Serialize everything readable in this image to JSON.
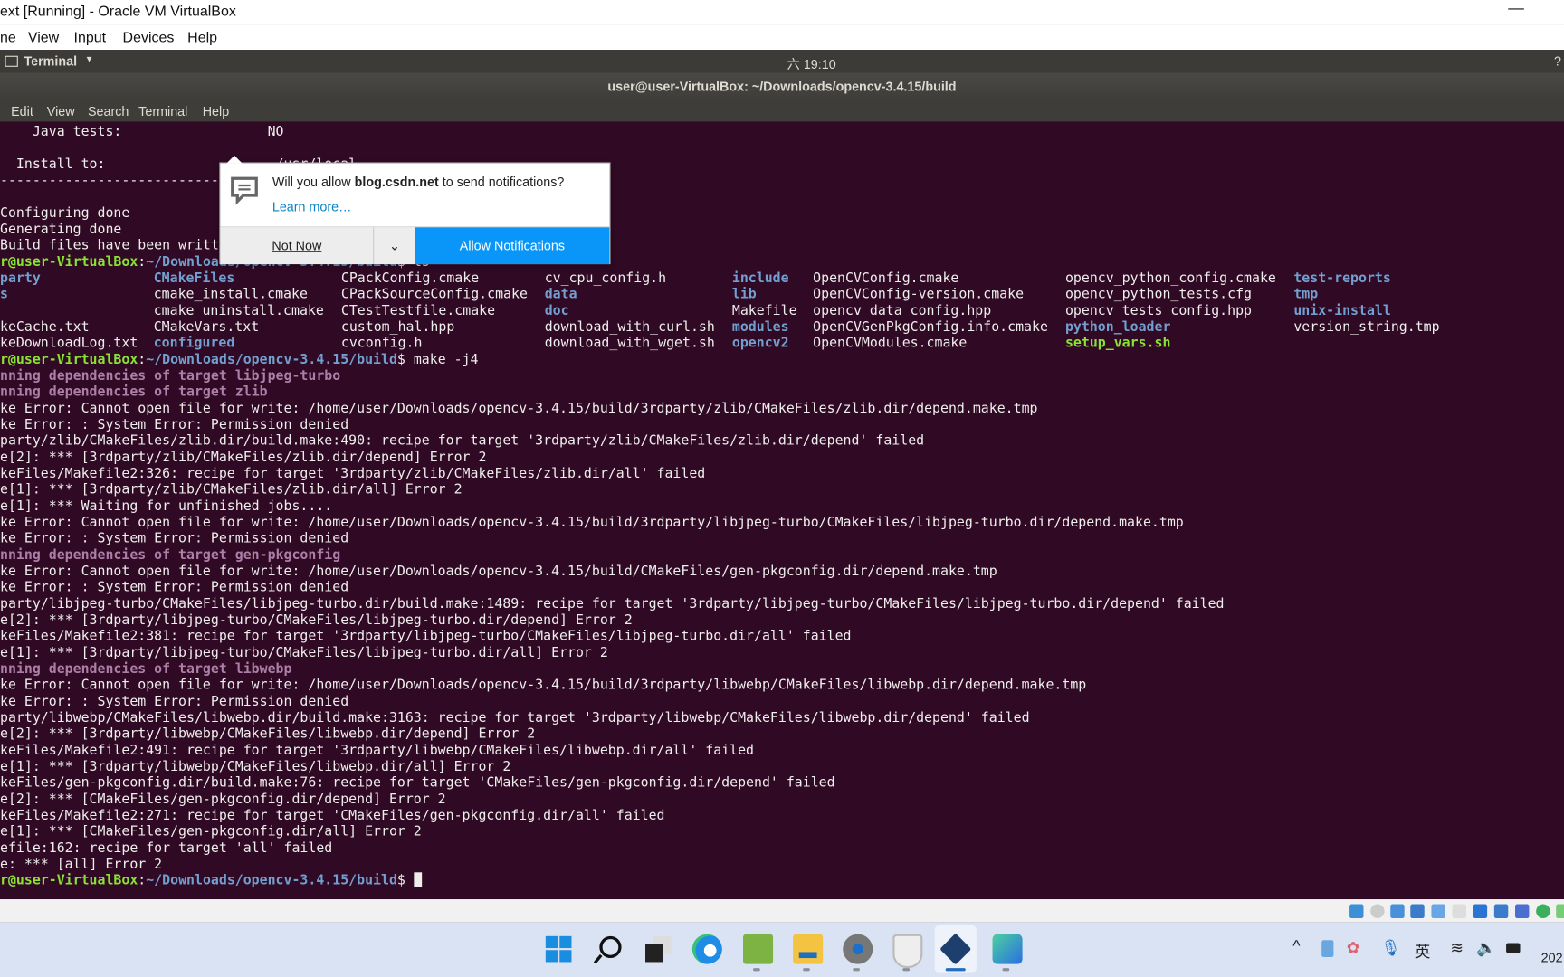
{
  "window": {
    "title": "ext [Running] - Oracle VM VirtualBox",
    "minimize": "—"
  },
  "vbox_menu": [
    "ne",
    "View",
    "Input",
    "Devices",
    "Help"
  ],
  "ubuntu_panel": {
    "app": "Terminal",
    "clock": "六 19:10",
    "right": "?"
  },
  "terminal": {
    "title": "user@user-VirtualBox: ~/Downloads/opencv-3.4.15/build",
    "menu": [
      "Edit",
      "View",
      "Search",
      "Terminal",
      "Help"
    ],
    "lines": [
      [
        {
          "t": "    Java tests:                  NO",
          "c": "n"
        }
      ],
      [],
      [
        {
          "t": "  Install to:                     /usr/local",
          "c": "n"
        }
      ],
      [
        {
          "t": "--------------------------------------------------------",
          "c": "n"
        }
      ],
      [],
      [
        {
          "t": "Configuring done",
          "c": "n"
        }
      ],
      [
        {
          "t": "Generating done",
          "c": "n"
        }
      ],
      [
        {
          "t": "Build files have been written to: /home/user/Downloads/opencv-3.4.15/build",
          "c": "n"
        }
      ],
      [
        {
          "t": "r@user-VirtualBox",
          "c": "u"
        },
        {
          "t": ":",
          "c": "n"
        },
        {
          "t": "~/Downloads/opencv-3.4.15/build",
          "c": "p"
        },
        {
          "t": "$ ls",
          "c": "n"
        }
      ],
      "LS0",
      "LS1",
      "LS2",
      "LS3",
      "LS4",
      [
        {
          "t": "r@user-VirtualBox",
          "c": "u"
        },
        {
          "t": ":",
          "c": "n"
        },
        {
          "t": "~/Downloads/opencv-3.4.15/build",
          "c": "p"
        },
        {
          "t": "$ make -j4",
          "c": "n"
        }
      ],
      [
        {
          "t": "nning dependencies of target libjpeg-turbo",
          "c": "m"
        }
      ],
      [
        {
          "t": "nning dependencies of target zlib",
          "c": "m"
        }
      ],
      [
        {
          "t": "ke Error: Cannot open file for write: /home/user/Downloads/opencv-3.4.15/build/3rdparty/zlib/CMakeFiles/zlib.dir/depend.make.tmp",
          "c": "n"
        }
      ],
      [
        {
          "t": "ke Error: : System Error: Permission denied",
          "c": "n"
        }
      ],
      [
        {
          "t": "party/zlib/CMakeFiles/zlib.dir/build.make:490: recipe for target '3rdparty/zlib/CMakeFiles/zlib.dir/depend' failed",
          "c": "n"
        }
      ],
      [
        {
          "t": "e[2]: *** [3rdparty/zlib/CMakeFiles/zlib.dir/depend] Error 2",
          "c": "n"
        }
      ],
      [
        {
          "t": "keFiles/Makefile2:326: recipe for target '3rdparty/zlib/CMakeFiles/zlib.dir/all' failed",
          "c": "n"
        }
      ],
      [
        {
          "t": "e[1]: *** [3rdparty/zlib/CMakeFiles/zlib.dir/all] Error 2",
          "c": "n"
        }
      ],
      [
        {
          "t": "e[1]: *** Waiting for unfinished jobs....",
          "c": "n"
        }
      ],
      [
        {
          "t": "ke Error: Cannot open file for write: /home/user/Downloads/opencv-3.4.15/build/3rdparty/libjpeg-turbo/CMakeFiles/libjpeg-turbo.dir/depend.make.tmp",
          "c": "n"
        }
      ],
      [
        {
          "t": "ke Error: : System Error: Permission denied",
          "c": "n"
        }
      ],
      [
        {
          "t": "nning dependencies of target gen-pkgconfig",
          "c": "m"
        }
      ],
      [
        {
          "t": "ke Error: Cannot open file for write: /home/user/Downloads/opencv-3.4.15/build/CMakeFiles/gen-pkgconfig.dir/depend.make.tmp",
          "c": "n"
        }
      ],
      [
        {
          "t": "ke Error: : System Error: Permission denied",
          "c": "n"
        }
      ],
      [
        {
          "t": "party/libjpeg-turbo/CMakeFiles/libjpeg-turbo.dir/build.make:1489: recipe for target '3rdparty/libjpeg-turbo/CMakeFiles/libjpeg-turbo.dir/depend' failed",
          "c": "n"
        }
      ],
      [
        {
          "t": "e[2]: *** [3rdparty/libjpeg-turbo/CMakeFiles/libjpeg-turbo.dir/depend] Error 2",
          "c": "n"
        }
      ],
      [
        {
          "t": "keFiles/Makefile2:381: recipe for target '3rdparty/libjpeg-turbo/CMakeFiles/libjpeg-turbo.dir/all' failed",
          "c": "n"
        }
      ],
      [
        {
          "t": "e[1]: *** [3rdparty/libjpeg-turbo/CMakeFiles/libjpeg-turbo.dir/all] Error 2",
          "c": "n"
        }
      ],
      [
        {
          "t": "nning dependencies of target libwebp",
          "c": "m"
        }
      ],
      [
        {
          "t": "ke Error: Cannot open file for write: /home/user/Downloads/opencv-3.4.15/build/3rdparty/libwebp/CMakeFiles/libwebp.dir/depend.make.tmp",
          "c": "n"
        }
      ],
      [
        {
          "t": "ke Error: : System Error: Permission denied",
          "c": "n"
        }
      ],
      [
        {
          "t": "party/libwebp/CMakeFiles/libwebp.dir/build.make:3163: recipe for target '3rdparty/libwebp/CMakeFiles/libwebp.dir/depend' failed",
          "c": "n"
        }
      ],
      [
        {
          "t": "e[2]: *** [3rdparty/libwebp/CMakeFiles/libwebp.dir/depend] Error 2",
          "c": "n"
        }
      ],
      [
        {
          "t": "keFiles/Makefile2:491: recipe for target '3rdparty/libwebp/CMakeFiles/libwebp.dir/all' failed",
          "c": "n"
        }
      ],
      [
        {
          "t": "e[1]: *** [3rdparty/libwebp/CMakeFiles/libwebp.dir/all] Error 2",
          "c": "n"
        }
      ],
      [
        {
          "t": "keFiles/gen-pkgconfig.dir/build.make:76: recipe for target 'CMakeFiles/gen-pkgconfig.dir/depend' failed",
          "c": "n"
        }
      ],
      [
        {
          "t": "e[2]: *** [CMakeFiles/gen-pkgconfig.dir/depend] Error 2",
          "c": "n"
        }
      ],
      [
        {
          "t": "keFiles/Makefile2:271: recipe for target 'CMakeFiles/gen-pkgconfig.dir/all' failed",
          "c": "n"
        }
      ],
      [
        {
          "t": "e[1]: *** [CMakeFiles/gen-pkgconfig.dir/all] Error 2",
          "c": "n"
        }
      ],
      [
        {
          "t": "efile:162: recipe for target 'all' failed",
          "c": "n"
        }
      ],
      [
        {
          "t": "e: *** [all] Error 2",
          "c": "n"
        }
      ],
      [
        {
          "t": "r@user-VirtualBox",
          "c": "u"
        },
        {
          "t": ":",
          "c": "n"
        },
        {
          "t": "~/Downloads/opencv-3.4.15/build",
          "c": "p"
        },
        {
          "t": "$ ",
          "c": "n"
        },
        {
          "t": "",
          "c": "cursor"
        }
      ]
    ],
    "ls_rows": [
      [
        {
          "t": "party",
          "c": "d"
        },
        {
          "t": "CMakeFiles",
          "c": "d"
        },
        {
          "t": "CPackConfig.cmake",
          "c": "n"
        },
        {
          "t": "cv_cpu_config.h",
          "c": "n"
        },
        {
          "t": "include",
          "c": "d"
        },
        {
          "t": "OpenCVConfig.cmake",
          "c": "n"
        },
        {
          "t": "opencv_python_config.cmake",
          "c": "n"
        },
        {
          "t": "test-reports",
          "c": "d"
        }
      ],
      [
        {
          "t": "s",
          "c": "d"
        },
        {
          "t": "cmake_install.cmake",
          "c": "n"
        },
        {
          "t": "CPackSourceConfig.cmake",
          "c": "n"
        },
        {
          "t": "data",
          "c": "d"
        },
        {
          "t": "lib",
          "c": "d"
        },
        {
          "t": "OpenCVConfig-version.cmake",
          "c": "n"
        },
        {
          "t": "opencv_python_tests.cfg",
          "c": "n"
        },
        {
          "t": "tmp",
          "c": "d"
        }
      ],
      [
        {
          "t": "",
          "c": "n"
        },
        {
          "t": "cmake_uninstall.cmake",
          "c": "n"
        },
        {
          "t": "CTestTestfile.cmake",
          "c": "n"
        },
        {
          "t": "doc",
          "c": "d"
        },
        {
          "t": "Makefile",
          "c": "n"
        },
        {
          "t": "opencv_data_config.hpp",
          "c": "n"
        },
        {
          "t": "opencv_tests_config.hpp",
          "c": "n"
        },
        {
          "t": "unix-install",
          "c": "d"
        }
      ],
      [
        {
          "t": "keCache.txt",
          "c": "n"
        },
        {
          "t": "CMakeVars.txt",
          "c": "n"
        },
        {
          "t": "custom_hal.hpp",
          "c": "n"
        },
        {
          "t": "download_with_curl.sh",
          "c": "n"
        },
        {
          "t": "modules",
          "c": "d"
        },
        {
          "t": "OpenCVGenPkgConfig.info.cmake",
          "c": "n"
        },
        {
          "t": "python_loader",
          "c": "d"
        },
        {
          "t": "version_string.tmp",
          "c": "n"
        }
      ],
      [
        {
          "t": "keDownloadLog.txt",
          "c": "n"
        },
        {
          "t": "configured",
          "c": "d"
        },
        {
          "t": "cvconfig.h",
          "c": "n"
        },
        {
          "t": "download_with_wget.sh",
          "c": "n"
        },
        {
          "t": "opencv2",
          "c": "d"
        },
        {
          "t": "OpenCVModules.cmake",
          "c": "n"
        },
        {
          "t": "setup_vars.sh",
          "c": "x"
        },
        {
          "t": "",
          "c": "n"
        }
      ]
    ]
  },
  "notification": {
    "prefix": "Will you allow ",
    "site": "blog.csdn.net",
    "suffix": " to send notifications?",
    "learn_more": "Learn more…",
    "not_now": "Not Now",
    "allow": "Allow Notifications",
    "icon": "chat-bubble-icon"
  },
  "taskbar": {
    "icons": [
      "windows-start-icon",
      "search-icon",
      "task-view-icon",
      "edge-icon",
      "notepad-plus-plus-icon",
      "file-explorer-icon",
      "settings-icon",
      "shield-icon",
      "virtualbox-icon",
      "app-icon"
    ],
    "tray": {
      "chevron": "^",
      "ime": "英",
      "clock_partial": "202"
    }
  },
  "colors": {
    "terminal_bg": "#300a24",
    "prompt_user": "#8ae234",
    "prompt_path": "#729fcf",
    "directory": "#729fcf",
    "target": "#ad7fa8",
    "allow_button": "#0996f8"
  }
}
